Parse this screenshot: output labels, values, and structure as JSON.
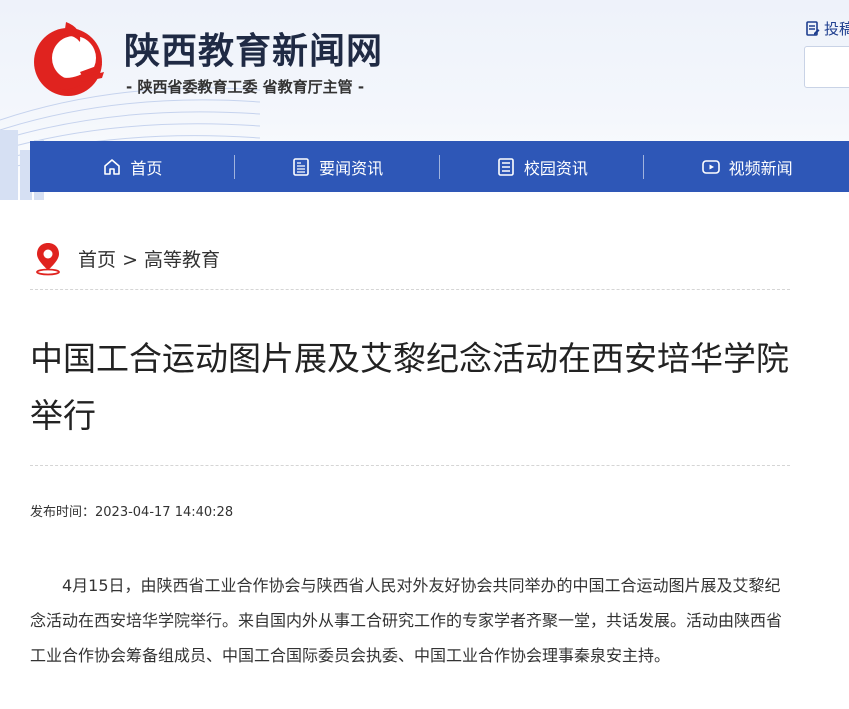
{
  "header": {
    "site_title": "陕西教育新闻网",
    "site_subtitle": "- 陕西省委教育工委  省教育厅主管 -",
    "submit_label": "投稿"
  },
  "nav": {
    "items": [
      {
        "label": "首页",
        "icon": "home-icon"
      },
      {
        "label": "要闻资讯",
        "icon": "news-icon"
      },
      {
        "label": "校园资讯",
        "icon": "list-icon"
      },
      {
        "label": "视频新闻",
        "icon": "video-icon"
      }
    ]
  },
  "breadcrumb": {
    "home": "首页",
    "separator": ">",
    "current": "高等教育"
  },
  "article": {
    "title": "中国工合运动图片展及艾黎纪念活动在西安培华学院举行",
    "meta_label": "发布时间：",
    "publish_time": "2023-04-17 14:40:28",
    "paragraph": "4月15日，由陕西省工业合作协会与陕西省人民对外友好协会共同举办的中国工合运动图片展及艾黎纪念活动在西安培华学院举行。来自国内外从事工合研究工作的专家学者齐聚一堂，共话发展。活动由陕西省工业合作协会筹备组成员、中国工合国际委员会执委、中国工业合作协会理事秦泉安主持。"
  },
  "colors": {
    "nav_bg": "#2e57b7",
    "logo_red": "#e0231f",
    "pin_red": "#e0231f"
  }
}
